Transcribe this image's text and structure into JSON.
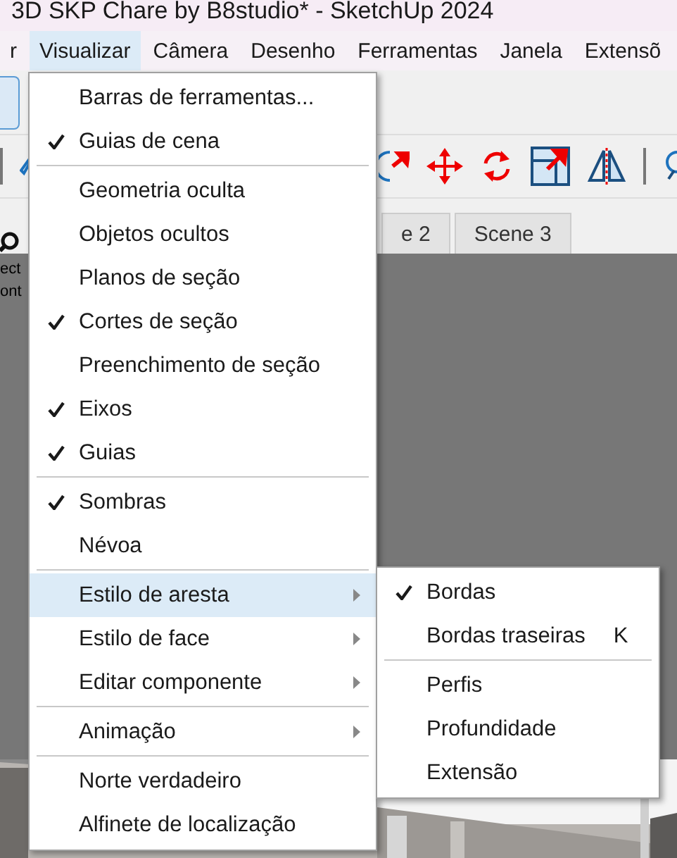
{
  "window": {
    "title": "3D SKP Chare by B8studio* - SketchUp 2024"
  },
  "menu_bar": [
    {
      "label": "r",
      "selected": false
    },
    {
      "label": "Visualizar",
      "selected": true
    },
    {
      "label": "Câmera",
      "selected": false
    },
    {
      "label": "Desenho",
      "selected": false
    },
    {
      "label": "Ferramentas",
      "selected": false
    },
    {
      "label": "Janela",
      "selected": false
    },
    {
      "label": "Extensõ",
      "selected": false
    }
  ],
  "scene_tabs": [
    {
      "label": "e 2"
    },
    {
      "label": "Scene 3"
    }
  ],
  "viewport_text": [
    "ect",
    "ont"
  ],
  "view_menu": {
    "groups": [
      [
        {
          "label": "Barras de ferramentas...",
          "submenu": false,
          "checked": false,
          "selected": false
        },
        {
          "label": "Guias de cena",
          "submenu": false,
          "checked": true,
          "selected": false
        }
      ],
      [
        {
          "label": "Geometria oculta",
          "submenu": false,
          "checked": false,
          "selected": false
        },
        {
          "label": "Objetos ocultos",
          "submenu": false,
          "checked": false,
          "selected": false
        },
        {
          "label": "Planos de seção",
          "submenu": false,
          "checked": false,
          "selected": false
        },
        {
          "label": "Cortes de seção",
          "submenu": false,
          "checked": true,
          "selected": false
        },
        {
          "label": "Preenchimento de seção",
          "submenu": false,
          "checked": false,
          "selected": false
        },
        {
          "label": "Eixos",
          "submenu": false,
          "checked": true,
          "selected": false
        },
        {
          "label": "Guias",
          "submenu": false,
          "checked": true,
          "selected": false
        }
      ],
      [
        {
          "label": "Sombras",
          "submenu": false,
          "checked": true,
          "selected": false
        },
        {
          "label": "Névoa",
          "submenu": false,
          "checked": false,
          "selected": false
        }
      ],
      [
        {
          "label": "Estilo de aresta",
          "submenu": true,
          "checked": false,
          "selected": true
        },
        {
          "label": "Estilo de face",
          "submenu": true,
          "checked": false,
          "selected": false
        },
        {
          "label": "Editar componente",
          "submenu": true,
          "checked": false,
          "selected": false
        }
      ],
      [
        {
          "label": "Animação",
          "submenu": true,
          "checked": false,
          "selected": false
        }
      ],
      [
        {
          "label": "Norte verdadeiro",
          "submenu": false,
          "checked": false,
          "selected": false
        },
        {
          "label": "Alfinete de localização",
          "submenu": false,
          "checked": false,
          "selected": false
        }
      ]
    ]
  },
  "edge_style_menu": {
    "groups": [
      [
        {
          "label": "Bordas",
          "checked": true,
          "selected": false
        },
        {
          "label": "Bordas traseiras",
          "checked": false,
          "selected": false,
          "shortcut": "K"
        }
      ],
      [
        {
          "label": "Perfis",
          "checked": false,
          "selected": false
        },
        {
          "label": "Profundidade",
          "checked": false,
          "selected": false
        },
        {
          "label": "Extensão",
          "checked": false,
          "selected": false
        }
      ]
    ]
  }
}
